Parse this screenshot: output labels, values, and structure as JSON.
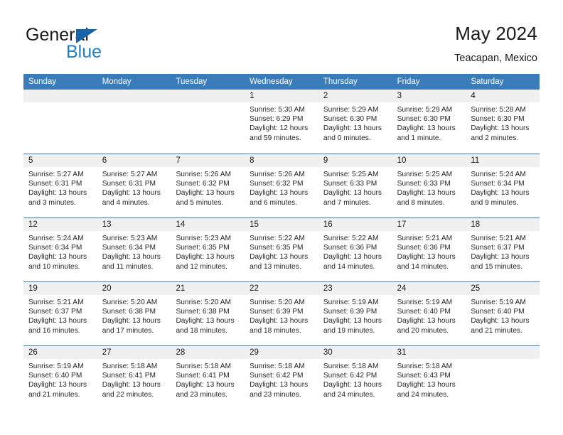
{
  "brand": {
    "name_part1": "General",
    "name_part2": "Blue",
    "colors": {
      "blue": "#1f7ec4",
      "triangle": "#1565a8",
      "header": "#3a7cb9"
    }
  },
  "header": {
    "title": "May 2024",
    "location": "Teacapan, Mexico"
  },
  "calendar": {
    "weekdays": [
      "Sunday",
      "Monday",
      "Tuesday",
      "Wednesday",
      "Thursday",
      "Friday",
      "Saturday"
    ],
    "weeks": [
      [
        {
          "num": "",
          "sunrise": "",
          "sunset": "",
          "daylight1": "",
          "daylight2": ""
        },
        {
          "num": "",
          "sunrise": "",
          "sunset": "",
          "daylight1": "",
          "daylight2": ""
        },
        {
          "num": "",
          "sunrise": "",
          "sunset": "",
          "daylight1": "",
          "daylight2": ""
        },
        {
          "num": "1",
          "sunrise": "Sunrise: 5:30 AM",
          "sunset": "Sunset: 6:29 PM",
          "daylight1": "Daylight: 12 hours",
          "daylight2": "and 59 minutes."
        },
        {
          "num": "2",
          "sunrise": "Sunrise: 5:29 AM",
          "sunset": "Sunset: 6:30 PM",
          "daylight1": "Daylight: 13 hours",
          "daylight2": "and 0 minutes."
        },
        {
          "num": "3",
          "sunrise": "Sunrise: 5:29 AM",
          "sunset": "Sunset: 6:30 PM",
          "daylight1": "Daylight: 13 hours",
          "daylight2": "and 1 minute."
        },
        {
          "num": "4",
          "sunrise": "Sunrise: 5:28 AM",
          "sunset": "Sunset: 6:30 PM",
          "daylight1": "Daylight: 13 hours",
          "daylight2": "and 2 minutes."
        }
      ],
      [
        {
          "num": "5",
          "sunrise": "Sunrise: 5:27 AM",
          "sunset": "Sunset: 6:31 PM",
          "daylight1": "Daylight: 13 hours",
          "daylight2": "and 3 minutes."
        },
        {
          "num": "6",
          "sunrise": "Sunrise: 5:27 AM",
          "sunset": "Sunset: 6:31 PM",
          "daylight1": "Daylight: 13 hours",
          "daylight2": "and 4 minutes."
        },
        {
          "num": "7",
          "sunrise": "Sunrise: 5:26 AM",
          "sunset": "Sunset: 6:32 PM",
          "daylight1": "Daylight: 13 hours",
          "daylight2": "and 5 minutes."
        },
        {
          "num": "8",
          "sunrise": "Sunrise: 5:26 AM",
          "sunset": "Sunset: 6:32 PM",
          "daylight1": "Daylight: 13 hours",
          "daylight2": "and 6 minutes."
        },
        {
          "num": "9",
          "sunrise": "Sunrise: 5:25 AM",
          "sunset": "Sunset: 6:33 PM",
          "daylight1": "Daylight: 13 hours",
          "daylight2": "and 7 minutes."
        },
        {
          "num": "10",
          "sunrise": "Sunrise: 5:25 AM",
          "sunset": "Sunset: 6:33 PM",
          "daylight1": "Daylight: 13 hours",
          "daylight2": "and 8 minutes."
        },
        {
          "num": "11",
          "sunrise": "Sunrise: 5:24 AM",
          "sunset": "Sunset: 6:34 PM",
          "daylight1": "Daylight: 13 hours",
          "daylight2": "and 9 minutes."
        }
      ],
      [
        {
          "num": "12",
          "sunrise": "Sunrise: 5:24 AM",
          "sunset": "Sunset: 6:34 PM",
          "daylight1": "Daylight: 13 hours",
          "daylight2": "and 10 minutes."
        },
        {
          "num": "13",
          "sunrise": "Sunrise: 5:23 AM",
          "sunset": "Sunset: 6:34 PM",
          "daylight1": "Daylight: 13 hours",
          "daylight2": "and 11 minutes."
        },
        {
          "num": "14",
          "sunrise": "Sunrise: 5:23 AM",
          "sunset": "Sunset: 6:35 PM",
          "daylight1": "Daylight: 13 hours",
          "daylight2": "and 12 minutes."
        },
        {
          "num": "15",
          "sunrise": "Sunrise: 5:22 AM",
          "sunset": "Sunset: 6:35 PM",
          "daylight1": "Daylight: 13 hours",
          "daylight2": "and 13 minutes."
        },
        {
          "num": "16",
          "sunrise": "Sunrise: 5:22 AM",
          "sunset": "Sunset: 6:36 PM",
          "daylight1": "Daylight: 13 hours",
          "daylight2": "and 14 minutes."
        },
        {
          "num": "17",
          "sunrise": "Sunrise: 5:21 AM",
          "sunset": "Sunset: 6:36 PM",
          "daylight1": "Daylight: 13 hours",
          "daylight2": "and 14 minutes."
        },
        {
          "num": "18",
          "sunrise": "Sunrise: 5:21 AM",
          "sunset": "Sunset: 6:37 PM",
          "daylight1": "Daylight: 13 hours",
          "daylight2": "and 15 minutes."
        }
      ],
      [
        {
          "num": "19",
          "sunrise": "Sunrise: 5:21 AM",
          "sunset": "Sunset: 6:37 PM",
          "daylight1": "Daylight: 13 hours",
          "daylight2": "and 16 minutes."
        },
        {
          "num": "20",
          "sunrise": "Sunrise: 5:20 AM",
          "sunset": "Sunset: 6:38 PM",
          "daylight1": "Daylight: 13 hours",
          "daylight2": "and 17 minutes."
        },
        {
          "num": "21",
          "sunrise": "Sunrise: 5:20 AM",
          "sunset": "Sunset: 6:38 PM",
          "daylight1": "Daylight: 13 hours",
          "daylight2": "and 18 minutes."
        },
        {
          "num": "22",
          "sunrise": "Sunrise: 5:20 AM",
          "sunset": "Sunset: 6:39 PM",
          "daylight1": "Daylight: 13 hours",
          "daylight2": "and 18 minutes."
        },
        {
          "num": "23",
          "sunrise": "Sunrise: 5:19 AM",
          "sunset": "Sunset: 6:39 PM",
          "daylight1": "Daylight: 13 hours",
          "daylight2": "and 19 minutes."
        },
        {
          "num": "24",
          "sunrise": "Sunrise: 5:19 AM",
          "sunset": "Sunset: 6:40 PM",
          "daylight1": "Daylight: 13 hours",
          "daylight2": "and 20 minutes."
        },
        {
          "num": "25",
          "sunrise": "Sunrise: 5:19 AM",
          "sunset": "Sunset: 6:40 PM",
          "daylight1": "Daylight: 13 hours",
          "daylight2": "and 21 minutes."
        }
      ],
      [
        {
          "num": "26",
          "sunrise": "Sunrise: 5:19 AM",
          "sunset": "Sunset: 6:40 PM",
          "daylight1": "Daylight: 13 hours",
          "daylight2": "and 21 minutes."
        },
        {
          "num": "27",
          "sunrise": "Sunrise: 5:18 AM",
          "sunset": "Sunset: 6:41 PM",
          "daylight1": "Daylight: 13 hours",
          "daylight2": "and 22 minutes."
        },
        {
          "num": "28",
          "sunrise": "Sunrise: 5:18 AM",
          "sunset": "Sunset: 6:41 PM",
          "daylight1": "Daylight: 13 hours",
          "daylight2": "and 23 minutes."
        },
        {
          "num": "29",
          "sunrise": "Sunrise: 5:18 AM",
          "sunset": "Sunset: 6:42 PM",
          "daylight1": "Daylight: 13 hours",
          "daylight2": "and 23 minutes."
        },
        {
          "num": "30",
          "sunrise": "Sunrise: 5:18 AM",
          "sunset": "Sunset: 6:42 PM",
          "daylight1": "Daylight: 13 hours",
          "daylight2": "and 24 minutes."
        },
        {
          "num": "31",
          "sunrise": "Sunrise: 5:18 AM",
          "sunset": "Sunset: 6:43 PM",
          "daylight1": "Daylight: 13 hours",
          "daylight2": "and 24 minutes."
        },
        {
          "num": "",
          "sunrise": "",
          "sunset": "",
          "daylight1": "",
          "daylight2": ""
        }
      ]
    ]
  }
}
